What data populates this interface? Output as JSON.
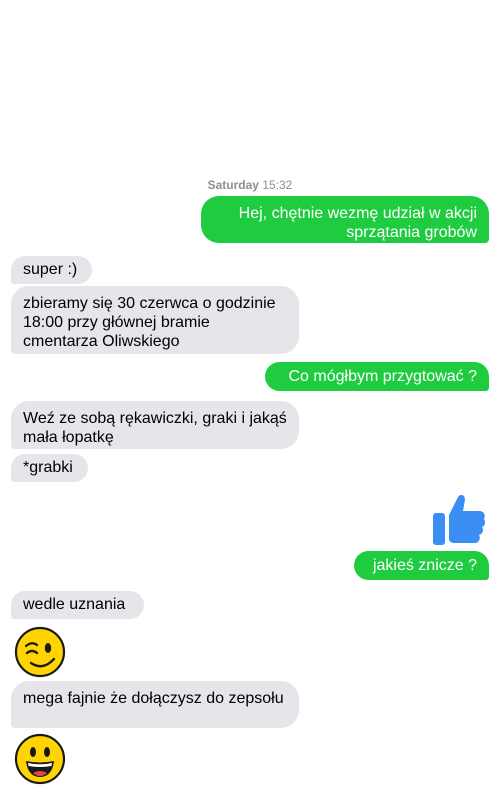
{
  "timestamp": {
    "day": "Saturday",
    "time": "15:32"
  },
  "messages": [
    {
      "from": "me",
      "text": "Hej, chętnie wezmę udział w akcji sprzątania grobów"
    },
    {
      "from": "them",
      "text": "super :)"
    },
    {
      "from": "them",
      "text": "zbieramy się 30 czerwca o godzinie 18:00 przy głównej bramie cmentarza Oliwskiego"
    },
    {
      "from": "me",
      "text": "Co mógłbym przygtować ?"
    },
    {
      "from": "them",
      "text": "Weź ze sobą rękawiczki, graki i jakąś mała łopatkę"
    },
    {
      "from": "them",
      "text": "*grabki"
    },
    {
      "from": "me",
      "sticker": "thumbs-up-icon"
    },
    {
      "from": "me",
      "text": "jakieś znicze ?"
    },
    {
      "from": "them",
      "text": "wedle uznania"
    },
    {
      "from": "them",
      "sticker": "winking-face-emoji"
    },
    {
      "from": "them",
      "text": "mega fajnie że dołączysz do zepsołu"
    },
    {
      "from": "them",
      "sticker": "grinning-face-emoji"
    }
  ],
  "colors": {
    "outgoing": "#1fcc40",
    "incoming": "#e5e5ea",
    "thumb": "#3b8ff2",
    "emoji": "#ffd400"
  }
}
